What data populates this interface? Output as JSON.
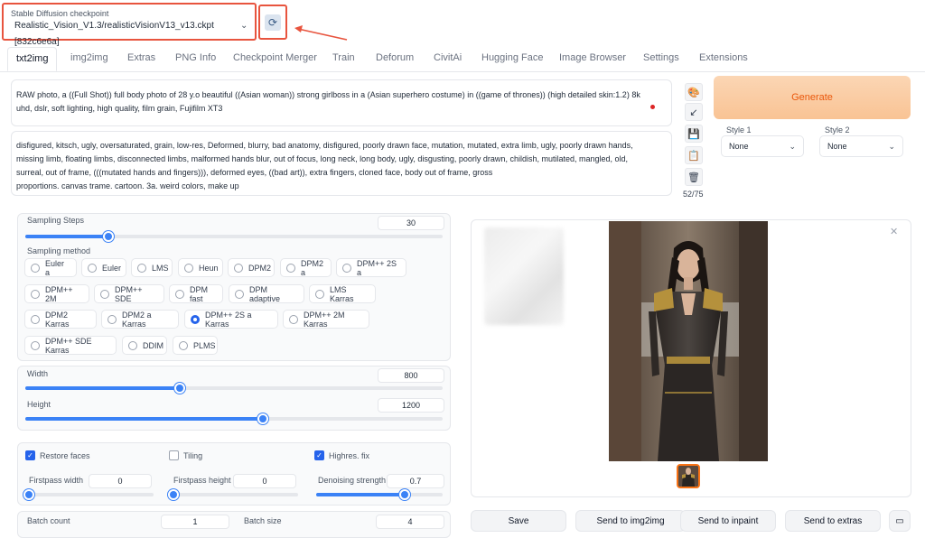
{
  "checkpoint": {
    "label": "Stable Diffusion checkpoint",
    "value": "Realistic_Vision_V1.3/realisticVisionV13_v13.ckpt [832c6e6a]"
  },
  "tabs": [
    {
      "label": "txt2img",
      "active": true
    },
    {
      "label": "img2img"
    },
    {
      "label": "Extras"
    },
    {
      "label": "PNG Info"
    },
    {
      "label": "Checkpoint Merger"
    },
    {
      "label": "Train"
    },
    {
      "label": "Deforum"
    },
    {
      "label": "CivitAi"
    },
    {
      "label": "Hugging Face"
    },
    {
      "label": "Image Browser"
    },
    {
      "label": "Settings"
    },
    {
      "label": "Extensions"
    }
  ],
  "prompt": {
    "line1": "RAW photo, a ((Full Shot)) full body photo of 28 y.o beautiful ((Asian woman)) strong girlboss in a (Asian superhero costume) in ((game of thrones))  (high detailed skin:1.2)  8k",
    "line2": "uhd, dslr, soft lighting, high quality, film grain, Fujifilm XT3"
  },
  "negative_prompt": {
    "line1": "disfigured, kitsch, ugly, oversaturated, grain, low-res, Deformed, blurry, bad anatomy, disfigured, poorly drawn face, mutation, mutated, extra limb, ugly, poorly drawn hands,",
    "line2": "missing limb, floating limbs, disconnected limbs, malformed hands blur, out of focus, long neck, long body, ugly, disgusting, poorly drawn, childish, mutilated, mangled, old,",
    "line3": "surreal, out of frame, (((mutated hands and fingers))), deformed eyes, ((bad art)), extra fingers, cloned face, body out of frame, gross",
    "line4": "proportions. canvas trame. cartoon. 3a. weird colors, make up"
  },
  "token_count": "52/75",
  "generate_label": "Generate",
  "style1": {
    "label": "Style 1",
    "value": "None"
  },
  "style2": {
    "label": "Style 2",
    "value": "None"
  },
  "sampling_steps": {
    "label": "Sampling Steps",
    "value": "30",
    "fraction": 0.2
  },
  "sampling_method": {
    "label": "Sampling method",
    "selected": "DPM++ 2S a Karras",
    "options": [
      "Euler a",
      "Euler",
      "LMS",
      "Heun",
      "DPM2",
      "DPM2 a",
      "DPM++ 2S a",
      "DPM++ 2M",
      "DPM++ SDE",
      "DPM fast",
      "DPM adaptive",
      "LMS Karras",
      "DPM2 Karras",
      "DPM2 a Karras",
      "DPM++ 2S a Karras",
      "DPM++ 2M Karras",
      "DPM++ SDE Karras",
      "DDIM",
      "PLMS"
    ]
  },
  "width": {
    "label": "Width",
    "value": "800",
    "fraction": 0.37
  },
  "height": {
    "label": "Height",
    "value": "1200",
    "fraction": 0.57
  },
  "restore_faces": {
    "label": "Restore faces",
    "checked": true
  },
  "tiling": {
    "label": "Tiling",
    "checked": false
  },
  "highres_fix": {
    "label": "Highres. fix",
    "checked": true
  },
  "firstpass_width": {
    "label": "Firstpass width",
    "value": "0",
    "fraction": 0.0
  },
  "firstpass_height": {
    "label": "Firstpass height",
    "value": "0",
    "fraction": 0.0
  },
  "denoising": {
    "label": "Denoising strength",
    "value": "0.7",
    "fraction": 0.7
  },
  "batch_count": {
    "label": "Batch count",
    "value": "1"
  },
  "batch_size": {
    "label": "Batch size",
    "value": "4"
  },
  "actions": {
    "save": "Save",
    "send_img2img": "Send to img2img",
    "send_inpaint": "Send to inpaint",
    "send_extras": "Send to extras"
  },
  "colors": {
    "accent": "#3b82f6",
    "highlight": "#e8543e",
    "generate": "#ea580c"
  }
}
